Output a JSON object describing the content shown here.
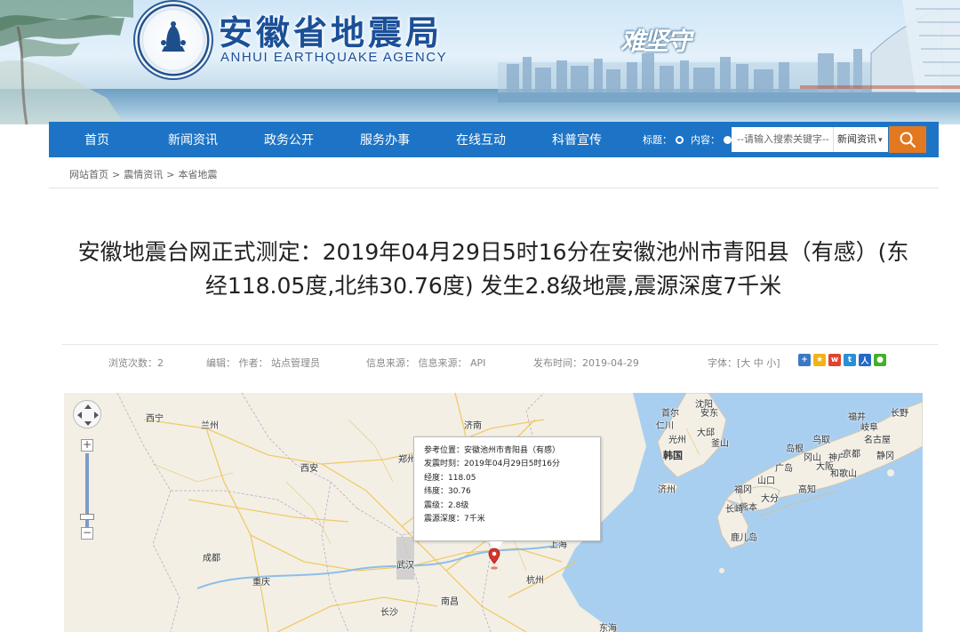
{
  "header": {
    "title": "安徽省地震局",
    "subtitle": "ANHUI EARTHQUAKE AGENCY",
    "slogan": "难坚守",
    "emblem_text": "CHINA EARTHQUAKE ADMINISTRATION"
  },
  "nav": {
    "items": [
      "首页",
      "新闻资讯",
      "政务公开",
      "服务办事",
      "在线互动",
      "科普宣传"
    ],
    "search": {
      "radio_title": "标题：",
      "radio_content": "内容：",
      "placeholder": "--请输入搜索关键字--",
      "category": "新闻资讯",
      "selected_radio": "标题"
    }
  },
  "breadcrumb": [
    "网站首页",
    "震情资讯",
    "本省地震"
  ],
  "article": {
    "title_line1": "安徽地震台网正式测定：2019年04月29日5时16分在安徽池州市青阳县（有感）(东",
    "title_line2": "经118.05度,北纬30.76度) 发生2.8级地震,震源深度7千米",
    "meta": {
      "views": "浏览次数：2",
      "editor": "编辑：  作者：  站点管理员",
      "source": "信息来源：  信息来源：  API",
      "date": "发布时间：2019-04-29",
      "font_size": "字体：[大 中 小]"
    }
  },
  "map": {
    "cities": [
      "西宁",
      "兰州",
      "西安",
      "郑州",
      "济南",
      "成都",
      "重庆",
      "武汉",
      "长沙",
      "南昌",
      "杭州",
      "上海",
      "沈阳",
      "首尔",
      "韩国",
      "济州",
      "福冈",
      "大分",
      "熊本",
      "长崎",
      "鹿儿岛",
      "广岛",
      "高知",
      "冈山",
      "神户",
      "大阪",
      "京都",
      "和歌山",
      "静冈",
      "长野",
      "名古屋",
      "岐阜",
      "东海",
      "安东",
      "大邱",
      "仁川",
      "光州",
      "釜山",
      "鸟取",
      "岛根",
      "山口",
      "福井"
    ],
    "popup": {
      "location": "参考位置：安徽池州市青阳县（有感）",
      "time": "发震时刻：2019年04月29日5时16分",
      "longitude": "经度：118.05",
      "latitude": "纬度：30.76",
      "magnitude": "震级：2.8级",
      "depth": "震源深度：7千米"
    },
    "marker_color": "#d7342a"
  },
  "colors": {
    "nav_bg": "#1d74c6",
    "title_blue": "#1b4f98",
    "search_button": "#e2781f",
    "sea": "#a9cff0"
  }
}
